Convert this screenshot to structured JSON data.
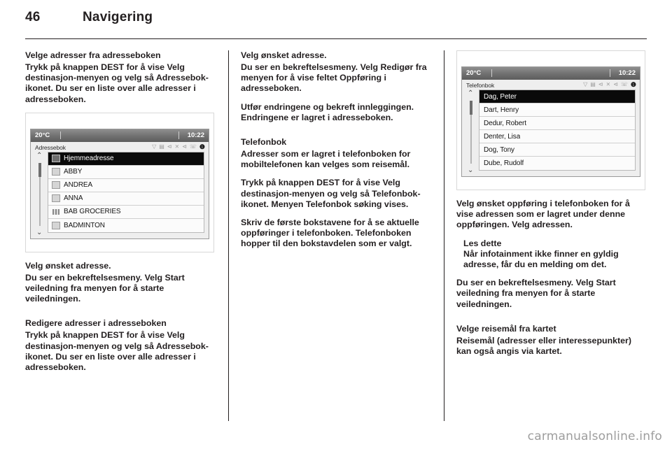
{
  "header": {
    "page_number": "46",
    "title": "Navigering"
  },
  "columns": {
    "left": {
      "heading_1": "Velge adresser fra adresseboken",
      "para_1": "Trykk på knappen DEST for å vise Velg destinasjon-menyen og velg så Adressebok-ikonet. Du ser en liste over alle adresser i adresseboken.",
      "para_2": "Velg ønsket adresse.",
      "para_3": "Du ser en bekreftelsesmeny. Velg Start veiledning fra menyen for å starte veiledningen.",
      "heading_2": "Redigere adresser i adresseboken",
      "para_4": "Trykk på knappen DEST for å vise Velg destinasjon-menyen og velg så Adressebok-ikonet. Du ser en liste over alle adresser i adresseboken."
    },
    "middle": {
      "para_1": "Velg ønsket adresse.",
      "para_2": "Du ser en bekreftelsesmeny. Velg Redigør fra menyen for å vise feltet Oppføring i adresseboken.",
      "para_3": "Utfør endringene og bekreft innleggingen. Endringene er lagret i adresseboken.",
      "heading_1": "Telefonbok",
      "para_4": "Adresser som er lagret i telefonboken for mobiltelefonen kan velges som reisemål.",
      "para_5": "Trykk på knappen DEST for å vise Velg destinasjon-menyen og velg så Telefonbok-ikonet. Menyen Telefonbok søking vises.",
      "para_6": "Skriv de første bokstavene for å se aktuelle oppføringer i telefonboken. Telefonboken hopper til den bokstavdelen som er valgt."
    },
    "right": {
      "para_1": "Velg ønsket oppføring i telefonboken for å vise adressen som er lagret under denne oppføringen. Velg adressen.",
      "note_title": "Les dette",
      "note_body": "Når infotainment ikke finner en gyldig adresse, får du en melding om det.",
      "para_2": "Du ser en bekreftelsesmeny. Velg Start veiledning fra menyen for å starte veiledningen.",
      "heading_1": "Velge reisemål fra kartet",
      "para_3": "Reisemål (adresser eller interessepunkter) kan også angis via kartet."
    }
  },
  "figure_addressbook": {
    "status": {
      "temperature": "20°C",
      "clock": "10:22",
      "icons": [
        {
          "name": "wifi-icon",
          "glyph": "▽"
        },
        {
          "name": "message-icon",
          "glyph": "▤"
        },
        {
          "name": "mute-icon",
          "glyph": "⊲"
        },
        {
          "name": "shuffle-icon",
          "glyph": "⨯"
        },
        {
          "name": "speaker-off-icon",
          "glyph": "⊲"
        },
        {
          "name": "phone-icon",
          "glyph": "☏"
        },
        {
          "name": "battery-icon",
          "glyph": "❶"
        }
      ]
    },
    "screen_title": "Adressebok",
    "scroll": {
      "up": "⌃",
      "down": "⌄"
    },
    "rows": [
      {
        "icon": "home-icon",
        "label": "Hjemmeadresse",
        "selected": true
      },
      {
        "icon": "contact-icon",
        "label": "ABBY",
        "selected": false
      },
      {
        "icon": "contact-icon",
        "label": "ANDREA",
        "selected": false
      },
      {
        "icon": "contact-icon",
        "label": "ANNA",
        "selected": false
      },
      {
        "icon": "store-icon",
        "label": "BAB GROCERIES",
        "selected": false
      },
      {
        "icon": "contact-icon",
        "label": "BADMINTON",
        "selected": false
      }
    ]
  },
  "figure_phonebook": {
    "status": {
      "temperature": "20°C",
      "clock": "10:22",
      "icons": [
        {
          "name": "wifi-icon",
          "glyph": "▽"
        },
        {
          "name": "message-icon",
          "glyph": "▤"
        },
        {
          "name": "mute-icon",
          "glyph": "⊲"
        },
        {
          "name": "shuffle-icon",
          "glyph": "⨯"
        },
        {
          "name": "speaker-off-icon",
          "glyph": "⊲"
        },
        {
          "name": "phone-icon",
          "glyph": "☏"
        },
        {
          "name": "battery-icon",
          "glyph": "❶"
        }
      ]
    },
    "screen_title": "Telefonbok",
    "scroll": {
      "up": "⌃",
      "down": "⌄"
    },
    "rows": [
      {
        "label": "Dag, Peter",
        "selected": true
      },
      {
        "label": "Dart, Henry",
        "selected": false
      },
      {
        "label": "Dedur, Robert",
        "selected": false
      },
      {
        "label": "Denter, Lisa",
        "selected": false
      },
      {
        "label": "Dog, Tony",
        "selected": false
      },
      {
        "label": "Dube, Rudolf",
        "selected": false
      }
    ]
  },
  "footer": {
    "watermark": "carmanualsonline.info"
  }
}
